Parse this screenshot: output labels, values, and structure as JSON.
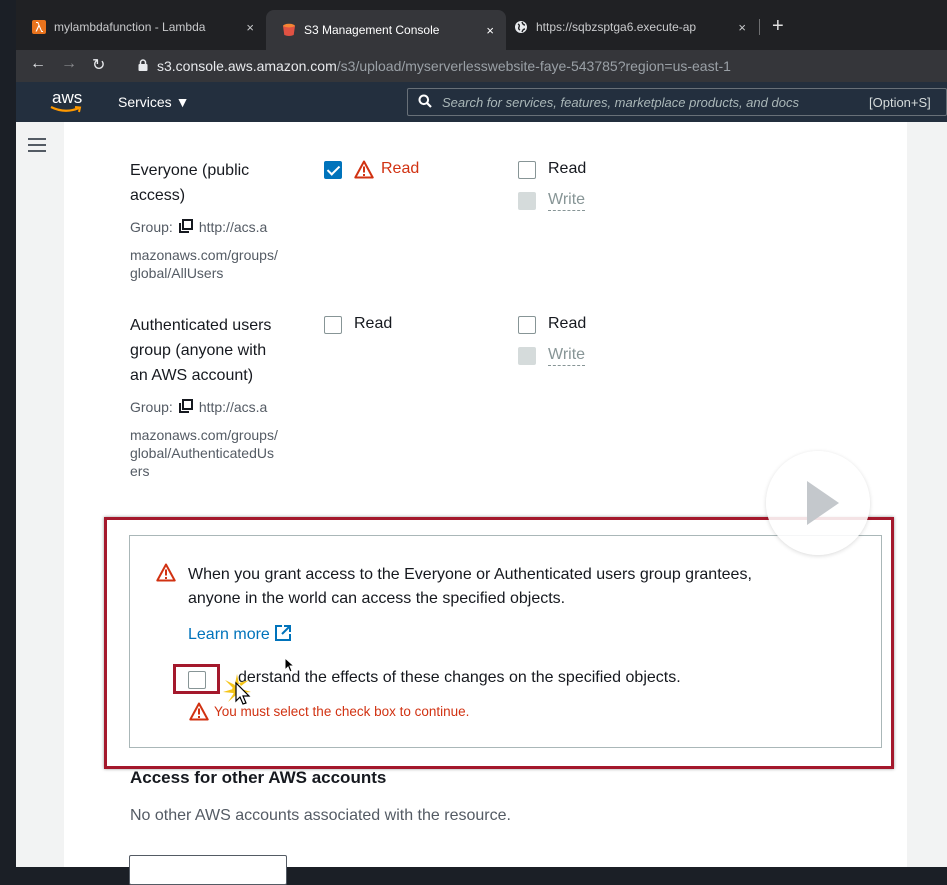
{
  "browser": {
    "tabs": [
      {
        "title": "mylambdafunction - Lambda",
        "icon": "lambda-icon",
        "active": false
      },
      {
        "title": "S3 Management Console",
        "icon": "s3-bucket-icon",
        "active": true
      },
      {
        "title": "https://sqbzsptga6.execute-ap",
        "icon": "globe-icon",
        "active": false
      }
    ],
    "tab_close": "×",
    "new_tab": "+",
    "url_domain": "s3.console.aws.amazon.com",
    "url_path": "/s3/upload/myserverlesswebsite-faye-543785?region=us-east-1"
  },
  "aws_header": {
    "logo": "aws",
    "services_label": "Services ▼",
    "search_placeholder": "Search for services, features, marketplace products, and docs",
    "search_shortcut": "[Option+S]"
  },
  "grantees": [
    {
      "name_lines": [
        "Everyone (public",
        "access)"
      ],
      "group_prefix": "Group:",
      "group_url_lines": [
        "http://acs.a",
        "mazonaws.com/groups/",
        "global/AllUsers"
      ],
      "objects_read_label": "Read",
      "objects_read_checked": true,
      "acl_read_label": "Read",
      "acl_write_label": "Write"
    },
    {
      "name_lines": [
        "Authenticated users",
        "group (anyone with",
        "an AWS account)"
      ],
      "group_prefix": "Group:",
      "group_url_lines": [
        "http://acs.a",
        "mazonaws.com/groups/",
        "global/AuthenticatedUs",
        "ers"
      ],
      "objects_read_label": "Read",
      "objects_read_checked": false,
      "acl_read_label": "Read",
      "acl_write_label": "Write"
    }
  ],
  "warning": {
    "message_lines": [
      "When you grant access to the Everyone or Authenticated users group grantees,",
      "anyone in the world can access the specified objects."
    ],
    "learn_more": "Learn more",
    "acknowledge_tail": "derstand the effects of these changes on the specified objects.",
    "error": "You must select the check box to continue."
  },
  "other_accounts": {
    "title": "Access for other AWS accounts",
    "text": "No other AWS accounts associated with the resource."
  },
  "colors": {
    "aws_navy": "#232f3e",
    "link_blue": "#0073bb",
    "error_red": "#d13212",
    "highlight_red": "#a4182c"
  }
}
